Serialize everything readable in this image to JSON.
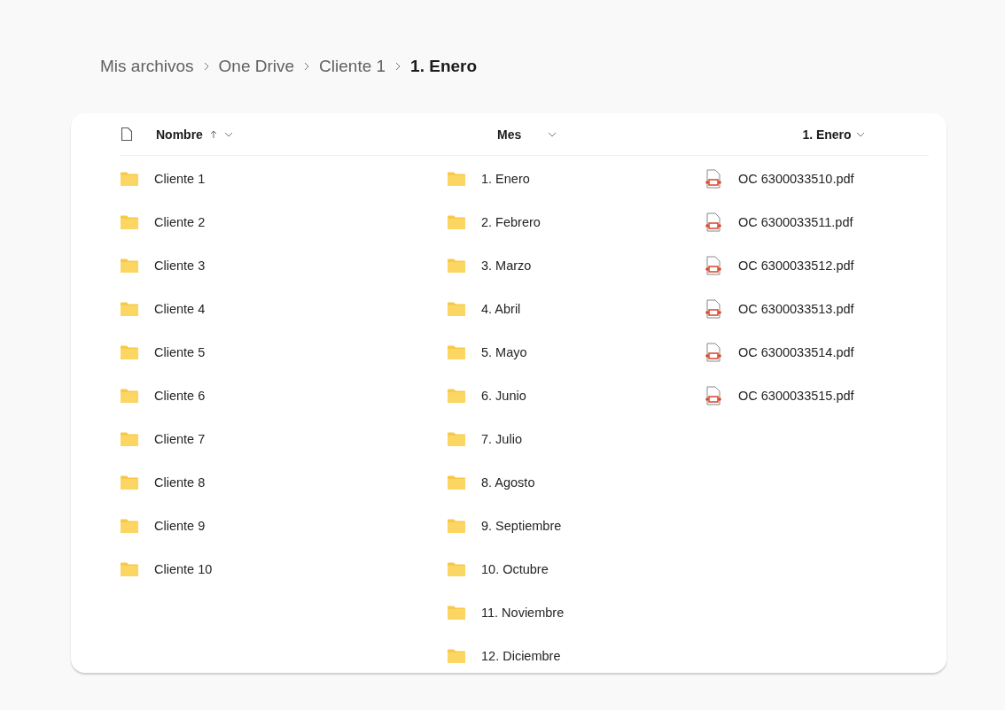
{
  "breadcrumb": [
    {
      "label": "Mis archivos",
      "current": false
    },
    {
      "label": "One Drive",
      "current": false
    },
    {
      "label": "Cliente 1",
      "current": false
    },
    {
      "label": "1. Enero",
      "current": true
    }
  ],
  "columns": [
    {
      "heading": "Nombre",
      "sorted_ascending": true,
      "items": [
        {
          "kind": "folder",
          "name": "Cliente 1"
        },
        {
          "kind": "folder",
          "name": "Cliente 2"
        },
        {
          "kind": "folder",
          "name": "Cliente 3"
        },
        {
          "kind": "folder",
          "name": "Cliente 4"
        },
        {
          "kind": "folder",
          "name": "Cliente 5"
        },
        {
          "kind": "folder",
          "name": "Cliente 6"
        },
        {
          "kind": "folder",
          "name": "Cliente 7"
        },
        {
          "kind": "folder",
          "name": "Cliente 8"
        },
        {
          "kind": "folder",
          "name": "Cliente 9"
        },
        {
          "kind": "folder",
          "name": "Cliente 10"
        }
      ]
    },
    {
      "heading": "Mes",
      "sorted_ascending": false,
      "items": [
        {
          "kind": "folder",
          "name": "1. Enero"
        },
        {
          "kind": "folder",
          "name": "2. Febrero"
        },
        {
          "kind": "folder",
          "name": "3. Marzo"
        },
        {
          "kind": "folder",
          "name": "4. Abril"
        },
        {
          "kind": "folder",
          "name": "5. Mayo"
        },
        {
          "kind": "folder",
          "name": "6. Junio"
        },
        {
          "kind": "folder",
          "name": "7. Julio"
        },
        {
          "kind": "folder",
          "name": "8. Agosto"
        },
        {
          "kind": "folder",
          "name": "9. Septiembre"
        },
        {
          "kind": "folder",
          "name": "10. Octubre"
        },
        {
          "kind": "folder",
          "name": "11. Noviembre"
        },
        {
          "kind": "folder",
          "name": "12. Diciembre"
        }
      ]
    },
    {
      "heading": "1. Enero",
      "sorted_ascending": false,
      "items": [
        {
          "kind": "pdf",
          "name": "OC 6300033510.pdf"
        },
        {
          "kind": "pdf",
          "name": "OC 6300033511.pdf"
        },
        {
          "kind": "pdf",
          "name": "OC 6300033512.pdf"
        },
        {
          "kind": "pdf",
          "name": "OC 6300033513.pdf"
        },
        {
          "kind": "pdf",
          "name": "OC 6300033514.pdf"
        },
        {
          "kind": "pdf",
          "name": "OC 6300033515.pdf"
        }
      ]
    }
  ]
}
